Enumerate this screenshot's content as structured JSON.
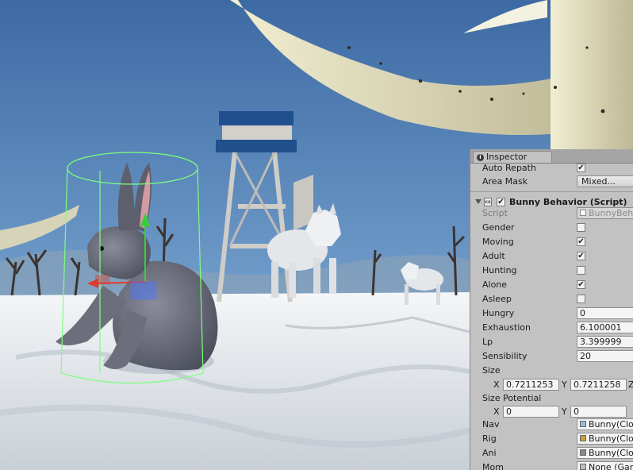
{
  "inspector": {
    "tab_label": "Inspector",
    "nav_agent": {
      "auto_repath_label": "Auto Repath",
      "auto_repath_checked": true,
      "area_mask_label": "Area Mask",
      "area_mask_value": "Mixed..."
    },
    "component": {
      "title": "Bunny Behavior (Script)",
      "enabled": true,
      "script_label": "Script",
      "script_value": "BunnyBeh",
      "toggles": [
        {
          "label": "Gender",
          "checked": false
        },
        {
          "label": "Moving",
          "checked": true
        },
        {
          "label": "Adult",
          "checked": true
        },
        {
          "label": "Hunting",
          "checked": false
        },
        {
          "label": "Alone",
          "checked": true
        },
        {
          "label": "Asleep",
          "checked": false
        }
      ],
      "numbers": [
        {
          "label": "Hungry",
          "value": "0"
        },
        {
          "label": "Exhaustion",
          "value": "6.100001"
        },
        {
          "label": "Lp",
          "value": "3.399999"
        },
        {
          "label": "Sensibility",
          "value": "20"
        }
      ],
      "size": {
        "label": "Size",
        "x_label": "X",
        "x": "0.7211253",
        "y_label": "Y",
        "y": "0.7211258",
        "z_label": "Z"
      },
      "size_potential": {
        "label": "Size Potential",
        "x_label": "X",
        "x": "0",
        "y_label": "Y",
        "y": "0"
      },
      "refs": [
        {
          "label": "Nav",
          "value": "Bunny(Clo"
        },
        {
          "label": "Rig",
          "value": "Bunny(Clo"
        },
        {
          "label": "Ani",
          "value": "Bunny(Clo"
        },
        {
          "label": "Mom",
          "value": "None (Gam"
        }
      ]
    }
  },
  "colors": {
    "sky": "#5a86b8",
    "snow": "#eef1f4",
    "inspector_bg": "#c2c2c2",
    "gizmo_green": "#7dff7d"
  }
}
